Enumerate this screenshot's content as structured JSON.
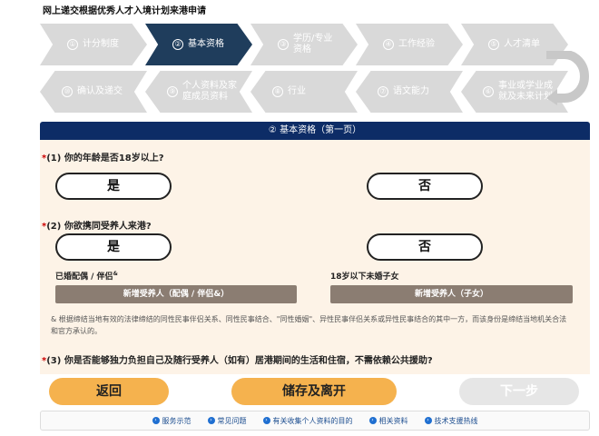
{
  "page_title": "网上递交根据优秀人才入境计划来港申请",
  "steps_top": [
    {
      "num": "①",
      "label": "计分制度"
    },
    {
      "num": "②",
      "label": "基本资格"
    },
    {
      "num": "③",
      "label": "学历/专业资格"
    },
    {
      "num": "④",
      "label": "工作经验"
    },
    {
      "num": "⑤",
      "label": "人才清单"
    }
  ],
  "steps_bottom": [
    {
      "num": "⑩",
      "label": "确认及递交"
    },
    {
      "num": "⑨",
      "label": "个人资料及家庭成员资料"
    },
    {
      "num": "⑧",
      "label": "行业"
    },
    {
      "num": "⑦",
      "label": "语文能力"
    },
    {
      "num": "⑥",
      "label": "事业或学业成就及未来计划"
    }
  ],
  "active_step": 2,
  "banner": "② 基本资格（第一页）",
  "q1": {
    "star": "*",
    "text": "(1) 你的年龄是否18岁以上?",
    "yes": "是",
    "no": "否"
  },
  "q2": {
    "star": "*",
    "text": "(2) 你欲携同受养人来港?",
    "yes": "是",
    "no": "否"
  },
  "spouse_label": "已婚配偶 / 伴侣",
  "spouse_sup": "&",
  "spouse_button": "新增受养人（配偶 / 伴侣&）",
  "child_label": "18岁以下未婚子女",
  "child_button": "新增受养人（子女）",
  "note": "& 根据缔结当地有效的法律缔结的同性民事伴侣关系、同性民事结合、\"同性婚姻\"、异性民事伴侣关系或异性民事结合的其中一方，而该身份是缔结当地机关合法和官方承认的。",
  "q3": {
    "star": "*",
    "text": "(3) 你是否能够独力负担自己及随行受养人（如有）居港期间的生活和住宿，不需依赖公共援助?"
  },
  "buttons": {
    "back": "返回",
    "save": "储存及离开",
    "next": "下一步"
  },
  "footer_links": [
    "服务示范",
    "常见问题",
    "有关收集个人资料的目的",
    "相关资料",
    "技术支援热线"
  ],
  "colors": {
    "active_step": "#1f3d5c",
    "banner": "#0d2c66",
    "orange": "#f5b24e",
    "grey_button": "#8b7d72"
  }
}
